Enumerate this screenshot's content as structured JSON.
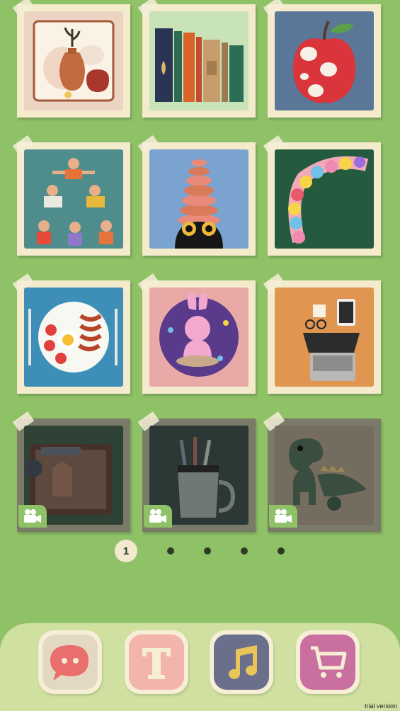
{
  "widgets": [
    {
      "name": "vase-art-widget",
      "bg": "#ecd4c3"
    },
    {
      "name": "books-art-widget",
      "bg": "#c8e3b8"
    },
    {
      "name": "apple-art-widget",
      "bg": "#5b7797"
    },
    {
      "name": "acrobats-art-widget",
      "bg": "#4f8d8c"
    },
    {
      "name": "donut-cat-art-widget",
      "bg": "#7aa4cf"
    },
    {
      "name": "flower-wreath-art-widget",
      "bg": "#245a3e"
    },
    {
      "name": "breakfast-art-widget",
      "bg": "#3d8fb8"
    },
    {
      "name": "bunny-art-widget",
      "bg": "#e9a9a6"
    },
    {
      "name": "laptop-art-widget",
      "bg": "#e09550"
    },
    {
      "name": "suitcase-art-widget",
      "bg": "#2e5a3e"
    },
    {
      "name": "toothbrush-art-widget",
      "bg": "#2f4a44"
    },
    {
      "name": "dinosaur-art-widget",
      "bg": "#9c8a6a"
    }
  ],
  "pagination": {
    "current": "1",
    "total_pages": 5
  },
  "dock": [
    {
      "name": "messages-app",
      "icon": "chat-bubble-icon",
      "color": "#e96f6d"
    },
    {
      "name": "text-app",
      "icon": "letter-t-icon",
      "color": "#f2b4ab"
    },
    {
      "name": "music-app",
      "icon": "music-note-icon",
      "color": "#6a6f8c"
    },
    {
      "name": "shop-app",
      "icon": "shopping-cart-icon",
      "color": "#c970a0"
    }
  ],
  "watermark": "trial version"
}
